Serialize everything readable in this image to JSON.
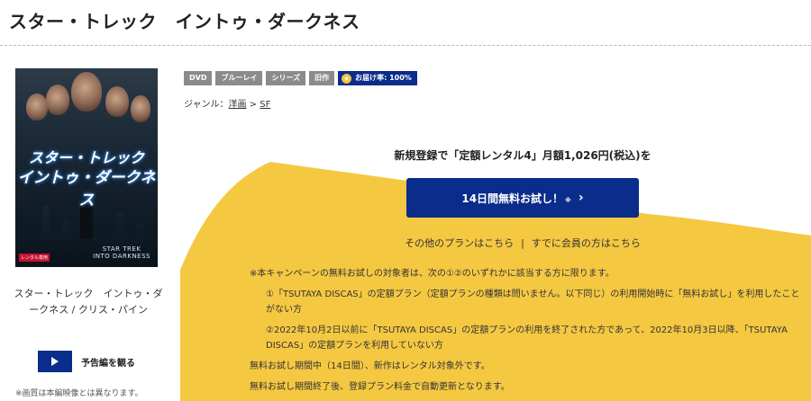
{
  "page": {
    "title": "スター・トレック　イントゥ・ダークネス"
  },
  "poster": {
    "jp_title_line1": "スター・トレック",
    "jp_title_line2": "イントゥ・ダークネス",
    "en_logo_line1": "STAR TREK",
    "en_logo_line2": "INTO DARKNESS",
    "badge": "レンタル専用"
  },
  "caption": {
    "line1": "スター・トレック　イントゥ・ダ",
    "line2": "ークネス / クリス・パイン"
  },
  "trailer": {
    "label": "予告編を観る"
  },
  "image_note": "※画質は本編映像とは異なります。",
  "tags": {
    "dvd": "DVD",
    "bluray": "ブルーレイ",
    "series": "シリーズ",
    "old": "旧作",
    "rate_label": "お届け率: 100%"
  },
  "genre": {
    "prefix": "ジャンル：",
    "level1": "洋画",
    "separator": " > ",
    "level2": "SF"
  },
  "promo": {
    "headline": "新規登録で「定額レンタル4」月額1,026円(税込)を",
    "cta_label": "14日間無料お試し！",
    "cta_mark": "※",
    "cta_chevron": "›",
    "other_plans": "その他のプランはこちら",
    "separator": "|",
    "member_link": "すでに会員の方はこちら"
  },
  "terms": {
    "intro": "※本キャンペーンの無料お試しの対象者は、次の①②のいずれかに該当する方に限ります。",
    "item1": "①「TSUTAYA DISCAS」の定額プラン（定額プランの種類は問いません。以下同じ）の利用開始時に「無料お試し」を利用したことがない方",
    "item2": "②2022年10月2日以前に「TSUTAYA DISCAS」の定額プランの利用を終了された方であって、2022年10月3日以降、「TSUTAYA DISCAS」の定額プランを利用していない方",
    "note1": "無料お試し期間中（14日間）、新作はレンタル対象外です。",
    "note2": "無料お試し期間終了後、登録プラン料金で自動更新となります。"
  },
  "colors": {
    "accent_blue": "#0a2c8a",
    "yellow": "#f5c842",
    "tag_gray": "#8b8b8b"
  }
}
